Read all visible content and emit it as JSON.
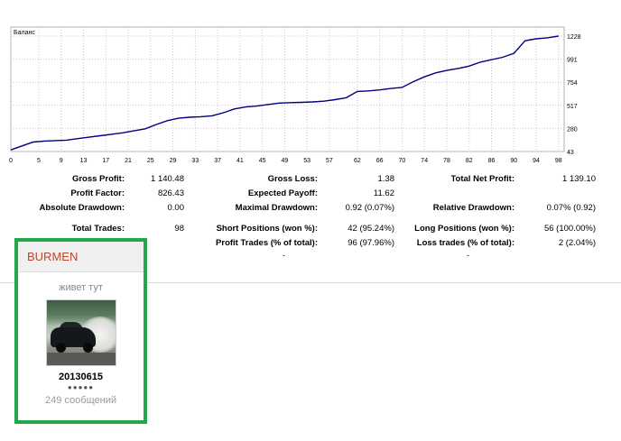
{
  "chart_data": {
    "type": "line",
    "title": "Баланс",
    "x_ticks": [
      "0",
      "5",
      "9",
      "13",
      "17",
      "21",
      "25",
      "29",
      "33",
      "37",
      "41",
      "45",
      "49",
      "53",
      "57",
      "62",
      "66",
      "70",
      "74",
      "78",
      "82",
      "86",
      "90",
      "94",
      "98"
    ],
    "y_ticks": [
      "1228",
      "991",
      "754",
      "517",
      "280",
      "43"
    ],
    "ylim": [
      43,
      1228
    ],
    "xlim": [
      0,
      99
    ],
    "grid": true,
    "series": [
      {
        "color": "#000080",
        "x": [
          0,
          2,
          4,
          6,
          8,
          10,
          12,
          14,
          16,
          18,
          20,
          22,
          24,
          26,
          28,
          30,
          32,
          34,
          36,
          38,
          40,
          42,
          44,
          46,
          48,
          50,
          52,
          54,
          56,
          58,
          60,
          62,
          64,
          66,
          68,
          70,
          72,
          74,
          76,
          78,
          80,
          82,
          84,
          86,
          88,
          90,
          92,
          94,
          96,
          98
        ],
        "y": [
          60,
          100,
          140,
          150,
          155,
          160,
          175,
          190,
          205,
          220,
          235,
          255,
          275,
          320,
          360,
          385,
          395,
          400,
          410,
          440,
          480,
          500,
          510,
          525,
          540,
          545,
          548,
          552,
          560,
          575,
          595,
          660,
          665,
          675,
          690,
          700,
          760,
          810,
          850,
          875,
          895,
          920,
          960,
          985,
          1010,
          1050,
          1180,
          1200,
          1210,
          1228
        ]
      }
    ]
  },
  "stats": {
    "gross_profit": {
      "label": "Gross Profit:",
      "value": "1 140.48"
    },
    "gross_loss": {
      "label": "Gross Loss:",
      "value": "1.38"
    },
    "total_net_profit": {
      "label": "Total Net Profit:",
      "value": "1 139.10"
    },
    "profit_factor": {
      "label": "Profit Factor:",
      "value": "826.43"
    },
    "expected_payoff": {
      "label": "Expected Payoff:",
      "value": "11.62"
    },
    "absolute_drawdown": {
      "label": "Absolute Drawdown:",
      "value": "0.00"
    },
    "maximal_drawdown": {
      "label": "Maximal Drawdown:",
      "value": "0.92 (0.07%)"
    },
    "relative_drawdown": {
      "label": "Relative Drawdown:",
      "value": "0.07% (0.92)"
    },
    "total_trades": {
      "label": "Total Trades:",
      "value": "98"
    },
    "short_positions": {
      "label": "Short Positions (won %):",
      "value": "42 (95.24%)"
    },
    "long_positions": {
      "label": "Long Positions (won %):",
      "value": "56 (100.00%)"
    },
    "profit_trades": {
      "label": "Profit Trades (% of total):",
      "value": "96 (97.96%)"
    },
    "loss_trades": {
      "label": "Loss trades (% of total):",
      "value": "2 (2.04%)"
    }
  },
  "profile": {
    "username": "BURMEN",
    "status": "живет тут",
    "reg_date": "20130615",
    "rank_dots": "●●●●●",
    "posts": "249 сообщений"
  }
}
